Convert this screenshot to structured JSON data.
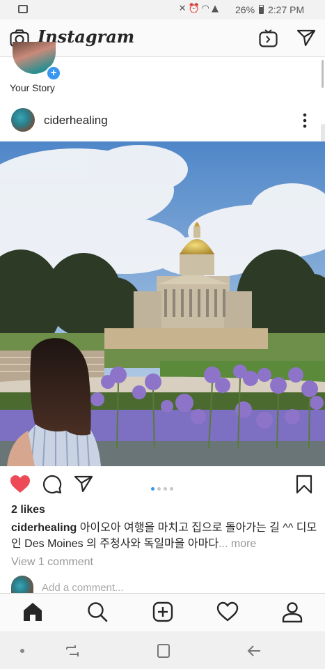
{
  "status_bar": {
    "battery": "26%",
    "time": "2:27 PM"
  },
  "header": {
    "title": "Instagram"
  },
  "stories": {
    "your_story_label": "Your Story",
    "add_symbol": "+"
  },
  "post": {
    "username": "ciderhealing",
    "likes": "2 likes",
    "caption_user": "ciderhealing",
    "caption_text": "아이오아 여행을 마치고 집으로 돌아가는 길 ^^ 디모인 Des Moines 의 주청사와 독일마을 아마다",
    "caption_more_ellipsis": "...",
    "caption_more": "more",
    "view_comments": "View 1 comment",
    "add_comment_placeholder": "Add a comment...",
    "liked": true,
    "carousel_total": 4,
    "carousel_active": 1
  },
  "icons": {
    "header": [
      "camera-icon",
      "igtv-icon",
      "direct-message-icon"
    ],
    "actions": [
      "heart-icon",
      "comment-icon",
      "share-icon",
      "bookmark-icon"
    ],
    "bottom_nav": [
      "home-icon",
      "search-icon",
      "add-post-icon",
      "activity-heart-icon",
      "profile-icon"
    ],
    "system_nav": [
      "recent-apps-icon",
      "home-square-icon",
      "back-arrow-icon"
    ]
  },
  "colors": {
    "like_red": "#ed4956",
    "accent_blue": "#3897f0",
    "muted_text": "#999999"
  }
}
